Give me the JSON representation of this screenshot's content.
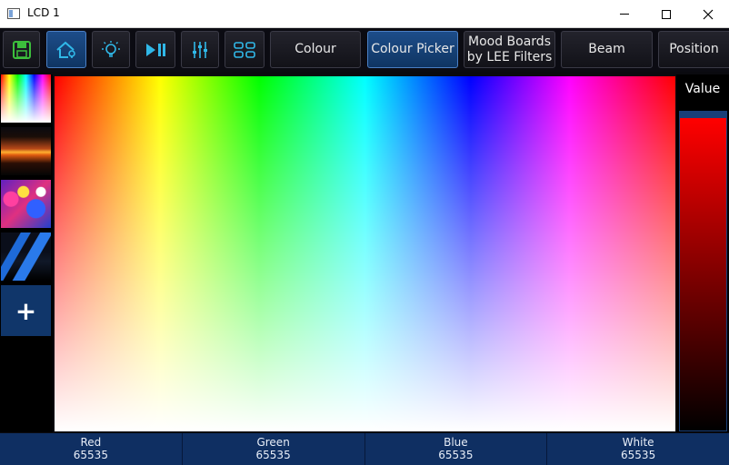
{
  "window": {
    "title": "LCD 1"
  },
  "toolbar": {
    "icons": [
      "save-icon",
      "home-icon",
      "lightbulb-icon",
      "play-pause-icon",
      "faders-icon",
      "layout-icon"
    ],
    "tabs": [
      {
        "label": "Colour",
        "active": false
      },
      {
        "label": "Colour Picker",
        "active": true
      },
      {
        "label_line1": "Mood Boards",
        "label_line2": "by LEE Filters",
        "active": false
      },
      {
        "label": "Beam",
        "active": false
      },
      {
        "label": "Position",
        "active": false
      }
    ]
  },
  "left_panel": {
    "thumbnails": [
      "colour-spectrum",
      "sunset",
      "abstract-lights",
      "blue-stage"
    ],
    "add_label": "+"
  },
  "right_panel": {
    "value_label": "Value"
  },
  "channels": [
    {
      "name": "Red",
      "value": "65535"
    },
    {
      "name": "Green",
      "value": "65535"
    },
    {
      "name": "Blue",
      "value": "65535"
    },
    {
      "name": "White",
      "value": "65535"
    }
  ],
  "colors": {
    "accent": "#1d4d8a",
    "bottom_bar": "#0f2f62",
    "icon": "#30b8e8",
    "save_icon": "#3cbf3c"
  }
}
